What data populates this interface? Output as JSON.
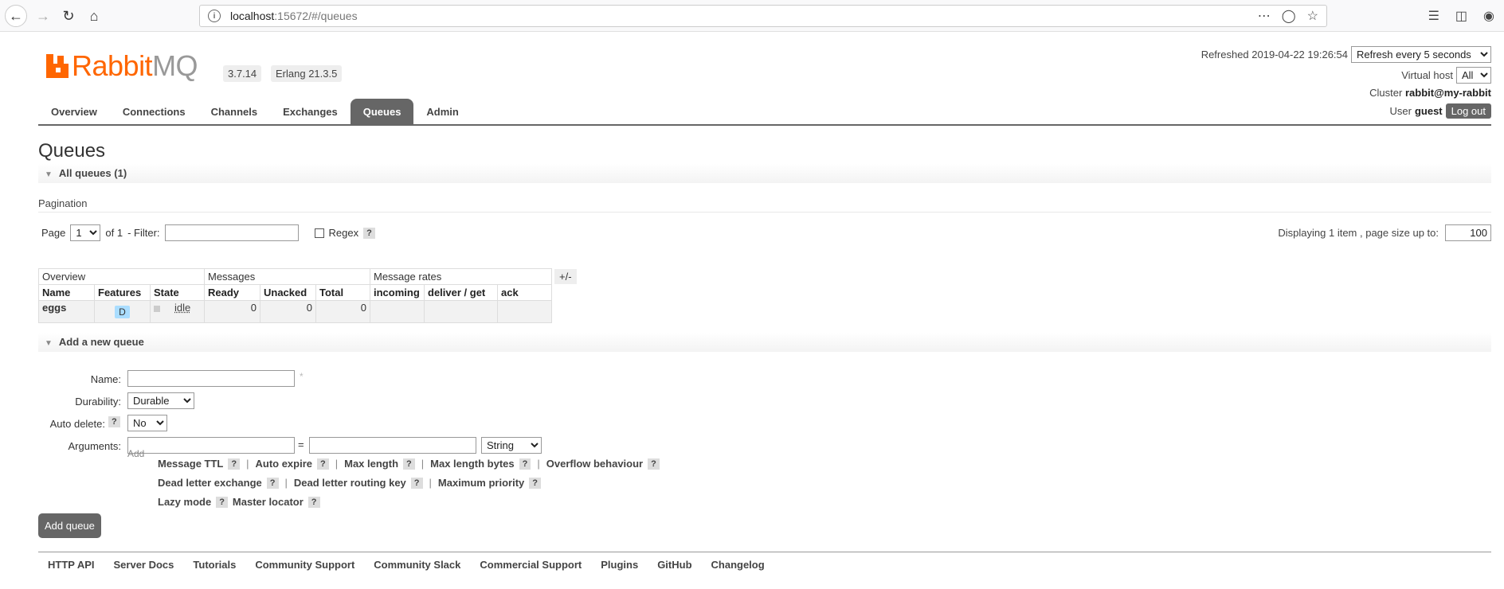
{
  "browser": {
    "url_host": "localhost",
    "url_path": ":15672/#/queues"
  },
  "header": {
    "logo_text_main": "Rabbit",
    "logo_text_mq": "MQ",
    "version": "3.7.14",
    "erlang": "Erlang 21.3.5",
    "refreshed_label": "Refreshed 2019-04-22 19:26:54",
    "refresh_option": "Refresh every 5 seconds",
    "virtual_host_label": "Virtual host",
    "virtual_host_value": "All",
    "cluster_label": "Cluster",
    "cluster_value": "rabbit@my-rabbit",
    "user_label": "User",
    "user_value": "guest",
    "logout_label": "Log out"
  },
  "tabs": [
    {
      "label": "Overview"
    },
    {
      "label": "Connections"
    },
    {
      "label": "Channels"
    },
    {
      "label": "Exchanges"
    },
    {
      "label": "Queues"
    },
    {
      "label": "Admin"
    }
  ],
  "page": {
    "title": "Queues",
    "all_queues_header": "All queues (1)",
    "pagination_label": "Pagination",
    "page_label": "Page",
    "page_value": "1",
    "of_label": "of 1",
    "filter_label": "- Filter:",
    "regex_label": "Regex",
    "help_q": "?",
    "displaying_label": "Displaying 1 item , page size up to:",
    "page_size": "100",
    "plus_minus": "+/-"
  },
  "table": {
    "groups": [
      "Overview",
      "Messages",
      "Message rates"
    ],
    "columns": [
      "Name",
      "Features",
      "State",
      "Ready",
      "Unacked",
      "Total",
      "incoming",
      "deliver / get",
      "ack"
    ],
    "rows": [
      {
        "name": "eggs",
        "feature": "D",
        "state": "idle",
        "ready": "0",
        "unacked": "0",
        "total": "0"
      }
    ]
  },
  "add_queue": {
    "header": "Add a new queue",
    "name_label": "Name:",
    "durability_label": "Durability:",
    "durability_value": "Durable",
    "auto_delete_label": "Auto delete:",
    "auto_delete_value": "No",
    "arguments_label": "Arguments:",
    "arg_type_value": "String",
    "eq": "=",
    "add_small": "Add",
    "arg_links_row1": [
      "Message TTL",
      "Auto expire",
      "Max length",
      "Max length bytes",
      "Overflow behaviour"
    ],
    "arg_links_row2": [
      "Dead letter exchange",
      "Dead letter routing key",
      "Maximum priority"
    ],
    "arg_links_row3": [
      "Lazy mode",
      "Master locator"
    ],
    "submit_label": "Add queue"
  },
  "footer": {
    "links": [
      "HTTP API",
      "Server Docs",
      "Tutorials",
      "Community Support",
      "Community Slack",
      "Commercial Support",
      "Plugins",
      "GitHub",
      "Changelog"
    ]
  }
}
